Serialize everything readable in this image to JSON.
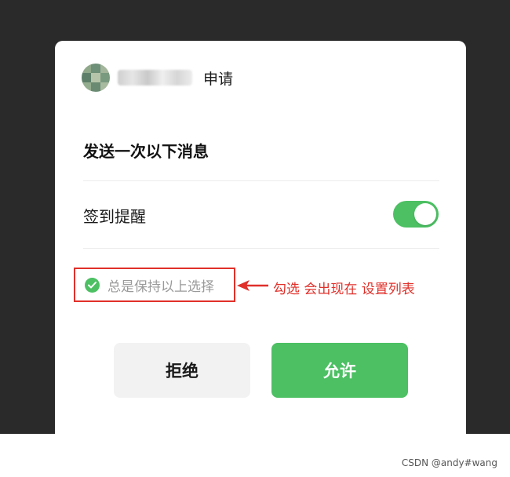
{
  "header": {
    "verb": "申请",
    "avatar_icon": "avatar-icon"
  },
  "dialog": {
    "title": "发送一次以下消息",
    "subscription_label": "签到提醒",
    "subscription_toggle_on": true,
    "keep_choice_label": "总是保持以上选择",
    "keep_choice_checked": true
  },
  "annotation": {
    "text": "勾选 会出现在 设置列表",
    "color": "#e0302a"
  },
  "buttons": {
    "reject_label": "拒绝",
    "allow_label": "允许"
  },
  "watermark": "CSDN @andy#wang",
  "colors": {
    "accent": "#4cc063",
    "annotation_red": "#e0302a"
  }
}
